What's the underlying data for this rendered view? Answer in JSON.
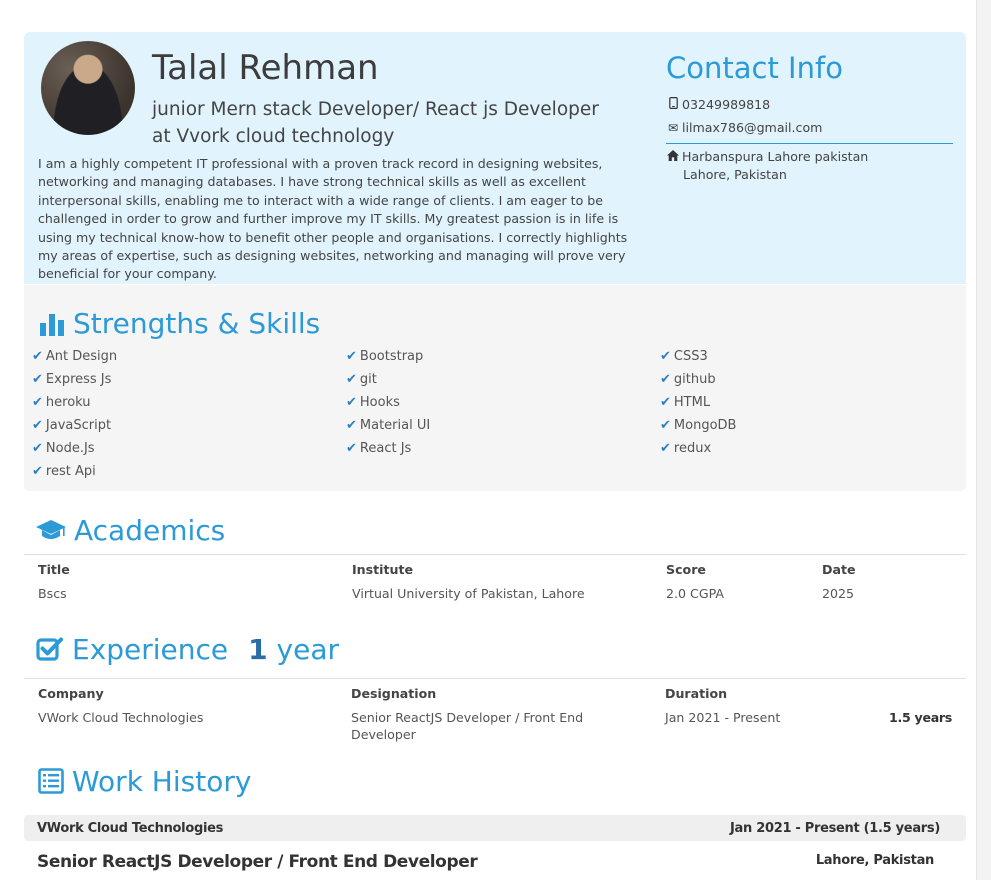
{
  "profile": {
    "name": "Talal Rehman",
    "role": "junior Mern stack Developer/ React js Developer at Vvork cloud technology",
    "summary": "I am a highly competent IT professional with a proven track record in designing websites, networking and managing databases. I have strong technical skills as well as excellent interpersonal skills, enabling me to interact with a wide range of clients. I am eager to be challenged in order to grow and further improve my IT skills. My greatest passion is in life is using my technical know-how to benefit other people and organisations. I correctly highlights my areas of expertise, such as designing websites, networking and managing will prove very beneficial for your company."
  },
  "contact": {
    "title": "Contact Info",
    "phone": "03249989818",
    "email": "lilmax786@gmail.com",
    "address_line1": "Harbanspura Lahore pakistan",
    "address_line2": "Lahore, Pakistan"
  },
  "skills": {
    "title": "Strengths & Skills",
    "items": [
      "Ant Design",
      "Express Js",
      "heroku",
      "JavaScript",
      "Node.Js",
      "rest Api",
      "Bootstrap",
      "git",
      "Hooks",
      "Material UI",
      "React Js",
      "CSS3",
      "github",
      "HTML",
      "MongoDB",
      "redux"
    ]
  },
  "academics": {
    "title": "Academics",
    "headers": [
      "Title",
      "Institute",
      "Score",
      "Date"
    ],
    "row": [
      "Bscs",
      "Virtual University of Pakistan, Lahore",
      "2.0 CGPA",
      "2025"
    ]
  },
  "experience": {
    "title": "Experience",
    "years_num": "1",
    "years_text": "year",
    "headers": [
      "Company",
      "Designation",
      "Duration"
    ],
    "company": "VWork Cloud Technologies",
    "designation": "Senior ReactJS Developer / Front End Developer",
    "duration": "Jan 2021 - Present",
    "duration_total": "1.5 years"
  },
  "work_history": {
    "title": "Work History",
    "company": "VWork Cloud Technologies",
    "dates": "Jan 2021 - Present  (1.5 years)",
    "role": "Senior ReactJS Developer / Front End Developer",
    "location": "Lahore, Pakistan"
  },
  "colors": {
    "accent": "#2b9ad6",
    "header_bg": "#e1f3fc",
    "panel_bg": "#f5f5f5"
  },
  "icons": [
    "phone-icon",
    "envelope-icon",
    "home-icon",
    "bar-chart-icon",
    "graduation-cap-icon",
    "checkbox-icon",
    "list-icon",
    "checkmark-icon"
  ]
}
